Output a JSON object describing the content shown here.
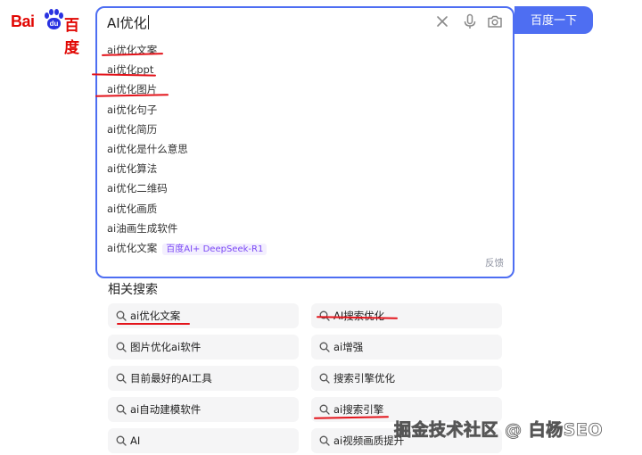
{
  "logo": {
    "latin": "Bai",
    "paw_text": "du",
    "chinese": "百度"
  },
  "search": {
    "query": "AI优化",
    "button_label": "百度一下",
    "feedback_label": "反馈",
    "suggestions": [
      {
        "text": "ai优化文案"
      },
      {
        "text": "ai优化ppt"
      },
      {
        "text": "ai优化图片"
      },
      {
        "text": "ai优化句子"
      },
      {
        "text": "ai优化简历"
      },
      {
        "text": "ai优化是什么意思"
      },
      {
        "text": "ai优化算法"
      },
      {
        "text": "ai优化二维码"
      },
      {
        "text": "ai优化画质"
      },
      {
        "text": "ai油画生成软件"
      },
      {
        "text": "ai优化文案",
        "tag": "百度AI+ DeepSeek-R1"
      }
    ]
  },
  "related": {
    "title": "相关搜索",
    "items": [
      "ai优化文案",
      "AI搜索优化",
      "图片优化ai软件",
      "ai增强",
      "目前最好的AI工具",
      "搜索引擎优化",
      "ai自动建模软件",
      "ai搜索引擎",
      "AI",
      "ai视频画质提升"
    ]
  },
  "watermark": "掘金技术社区 @ 白杨SEO",
  "colors": {
    "accent": "#4e6ef2",
    "brand_red": "#e10602",
    "paw_blue": "#2932e1",
    "underline_red": "#e3141b",
    "ai_tag": "#7b48f5"
  },
  "icons": {
    "clear": "close-icon",
    "voice": "microphone-icon",
    "camera": "camera-icon",
    "related": "search-icon"
  }
}
